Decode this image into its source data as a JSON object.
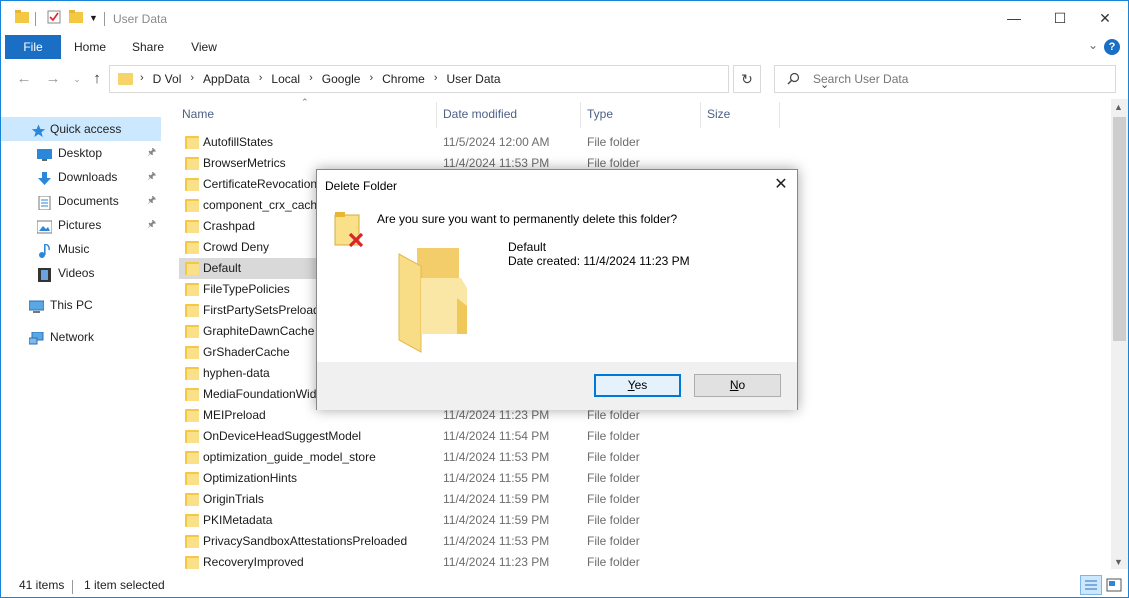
{
  "titlebar": {
    "title": "User Data",
    "icons": [
      "folder-icon",
      "properties-icon",
      "new-folder-icon",
      "customize-qa-icon"
    ],
    "minimize": "—",
    "maximize": "☐",
    "close": "✕"
  },
  "ribbon": {
    "tabs": [
      {
        "label": "File"
      },
      {
        "label": "Home"
      },
      {
        "label": "Share"
      },
      {
        "label": "View"
      }
    ],
    "help": "?"
  },
  "addressbar": {
    "crumbs": [
      "D Vol",
      "AppData",
      "Local",
      "Google",
      "Chrome",
      "User Data"
    ],
    "search_placeholder": "Search User Data"
  },
  "navpane": {
    "items": [
      {
        "label": "Quick access",
        "icon": "star-icon",
        "selected": true
      },
      {
        "label": "Desktop",
        "icon": "desktop-icon",
        "pinned": true
      },
      {
        "label": "Downloads",
        "icon": "download-icon",
        "pinned": true
      },
      {
        "label": "Documents",
        "icon": "documents-icon",
        "pinned": true
      },
      {
        "label": "Pictures",
        "icon": "pictures-icon",
        "pinned": true
      },
      {
        "label": "Music",
        "icon": "music-icon"
      },
      {
        "label": "Videos",
        "icon": "videos-icon"
      },
      {
        "label": "This PC",
        "icon": "computer-icon"
      },
      {
        "label": "Network",
        "icon": "network-icon"
      }
    ]
  },
  "filelist": {
    "columns": {
      "name": "Name",
      "date": "Date modified",
      "type": "Type",
      "size": "Size"
    },
    "rows": [
      {
        "name": "AutofillStates",
        "date": "11/5/2024 12:00 AM",
        "type": "File folder"
      },
      {
        "name": "BrowserMetrics",
        "date": "11/4/2024 11:53 PM",
        "type": "File folder"
      },
      {
        "name": "CertificateRevocation",
        "date": "",
        "type": ""
      },
      {
        "name": "component_crx_cach",
        "date": "",
        "type": ""
      },
      {
        "name": "Crashpad",
        "date": "",
        "type": ""
      },
      {
        "name": "Crowd Deny",
        "date": "",
        "type": ""
      },
      {
        "name": "Default",
        "date": "",
        "type": "",
        "selected": true
      },
      {
        "name": "FileTypePolicies",
        "date": "",
        "type": ""
      },
      {
        "name": "FirstPartySetsPreloade",
        "date": "",
        "type": ""
      },
      {
        "name": "GraphiteDawnCache",
        "date": "",
        "type": ""
      },
      {
        "name": "GrShaderCache",
        "date": "",
        "type": ""
      },
      {
        "name": "hyphen-data",
        "date": "",
        "type": ""
      },
      {
        "name": "MediaFoundationWid",
        "date": "",
        "type": ""
      },
      {
        "name": "MEIPreload",
        "date": "11/4/2024 11:23 PM",
        "type": "File folder"
      },
      {
        "name": "OnDeviceHeadSuggestModel",
        "date": "11/4/2024 11:54 PM",
        "type": "File folder"
      },
      {
        "name": "optimization_guide_model_store",
        "date": "11/4/2024 11:53 PM",
        "type": "File folder"
      },
      {
        "name": "OptimizationHints",
        "date": "11/4/2024 11:55 PM",
        "type": "File folder"
      },
      {
        "name": "OriginTrials",
        "date": "11/4/2024 11:59 PM",
        "type": "File folder"
      },
      {
        "name": "PKIMetadata",
        "date": "11/4/2024 11:59 PM",
        "type": "File folder"
      },
      {
        "name": "PrivacySandboxAttestationsPreloaded",
        "date": "11/4/2024 11:53 PM",
        "type": "File folder"
      },
      {
        "name": "RecoveryImproved",
        "date": "11/4/2024 11:23 PM",
        "type": "File folder"
      }
    ]
  },
  "statusbar": {
    "items_count": "41 items",
    "selected": "1 item selected"
  },
  "dialog": {
    "title": "Delete Folder",
    "question": "Are you sure you want to permanently delete this folder?",
    "folder_name": "Default",
    "date_created": "Date created: 11/4/2024 11:23 PM",
    "yes_label": "Yes",
    "no_label": "No",
    "close": "✕"
  },
  "colors": {
    "accent": "#1a6fc4",
    "selection": "#cce8ff",
    "folder": "#f5c843",
    "delete_x": "#d9232e"
  }
}
